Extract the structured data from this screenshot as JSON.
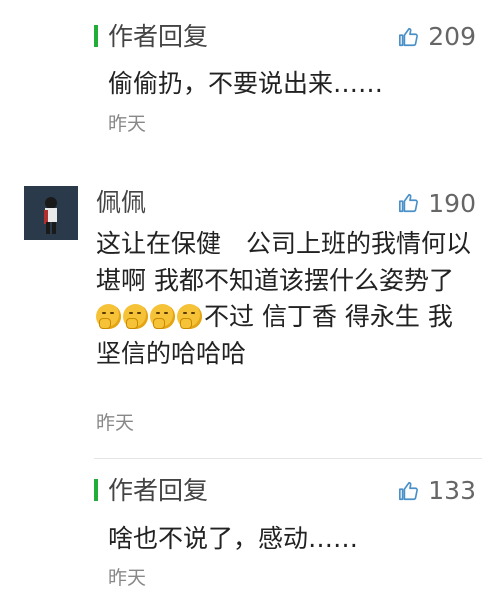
{
  "reply_1": {
    "author_label": "作者回复",
    "likes": "209",
    "text": "偷偷扔，不要说出来……",
    "time": "昨天"
  },
  "comment": {
    "user_name": "佩佩",
    "likes": "190",
    "text_part1": "这让在保健　公司上班的我情何以堪啊 我都不知道该摆什么姿势了",
    "emoji_name": "thinking-face-emoji",
    "text_part2": "不过 信丁香 得永生 我坚信的哈哈哈",
    "time": "昨天"
  },
  "reply_2": {
    "author_label": "作者回复",
    "likes": "133",
    "text": "啥也不说了，感动……",
    "time": "昨天"
  },
  "colors": {
    "accent_green": "#22ac38",
    "like_icon": "#4a90c8"
  }
}
